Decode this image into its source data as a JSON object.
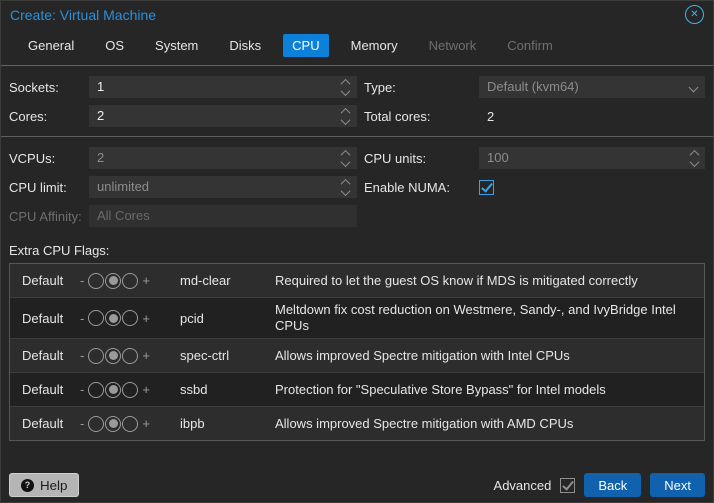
{
  "window": {
    "title": "Create: Virtual Machine",
    "close_icon": "✕"
  },
  "tabs": [
    {
      "label": "General",
      "state": "normal"
    },
    {
      "label": "OS",
      "state": "normal"
    },
    {
      "label": "System",
      "state": "normal"
    },
    {
      "label": "Disks",
      "state": "normal"
    },
    {
      "label": "CPU",
      "state": "active"
    },
    {
      "label": "Memory",
      "state": "normal"
    },
    {
      "label": "Network",
      "state": "disabled"
    },
    {
      "label": "Confirm",
      "state": "disabled"
    }
  ],
  "form": {
    "sockets": {
      "label": "Sockets:",
      "value": "1"
    },
    "cores": {
      "label": "Cores:",
      "value": "2"
    },
    "type": {
      "label": "Type:",
      "value": "Default (kvm64)"
    },
    "total_cores": {
      "label": "Total cores:",
      "value": "2"
    },
    "vcpus": {
      "label": "VCPUs:",
      "value": "2"
    },
    "cpu_limit": {
      "label": "CPU limit:",
      "value": "unlimited"
    },
    "cpu_affinity": {
      "label": "CPU Affinity:",
      "value": "All Cores"
    },
    "cpu_units": {
      "label": "CPU units:",
      "value": "100"
    },
    "enable_numa": {
      "label": "Enable NUMA:",
      "checked": true
    }
  },
  "flags_section": {
    "label": "Extra CPU Flags:",
    "slider_minus": "-",
    "slider_plus": "+",
    "rows": [
      {
        "state": "Default",
        "flag": "md-clear",
        "description": "Required to let the guest OS know if MDS is mitigated correctly"
      },
      {
        "state": "Default",
        "flag": "pcid",
        "description": "Meltdown fix cost reduction on Westmere, Sandy-, and IvyBridge Intel CPUs"
      },
      {
        "state": "Default",
        "flag": "spec-ctrl",
        "description": "Allows improved Spectre mitigation with Intel CPUs"
      },
      {
        "state": "Default",
        "flag": "ssbd",
        "description": "Protection for \"Speculative Store Bypass\" for Intel models"
      },
      {
        "state": "Default",
        "flag": "ibpb",
        "description": "Allows improved Spectre mitigation with AMD CPUs"
      }
    ]
  },
  "footer": {
    "help": "Help",
    "help_icon": "?",
    "advanced_label": "Advanced",
    "advanced_checked": true,
    "back": "Back",
    "next": "Next"
  },
  "colors": {
    "accent_blue": "#0d80da",
    "title_blue": "#2e8fd8",
    "checkbox_blue": "#38a1e8",
    "button_blue": "#1062ae",
    "background": "#262626"
  }
}
